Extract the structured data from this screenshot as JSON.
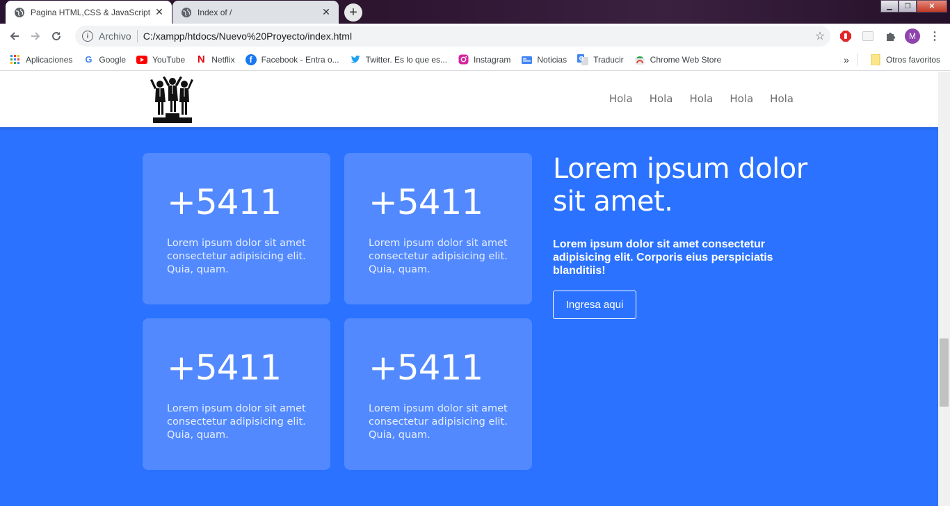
{
  "browser": {
    "tabs": [
      {
        "title": "Pagina HTML,CSS & JavaScript",
        "active": true
      },
      {
        "title": "Index of /",
        "active": false
      }
    ],
    "new_tab_label": "+",
    "address": {
      "scheme_label": "Archivo",
      "url": "C:/xampp/htdocs/Nuevo%20Proyecto/index.html"
    },
    "profile_initial": "M",
    "bookmarks": [
      {
        "label": "Aplicaciones",
        "icon": "apps-grid-icon"
      },
      {
        "label": "Google",
        "icon": "google-icon"
      },
      {
        "label": "YouTube",
        "icon": "youtube-icon"
      },
      {
        "label": "Netflix",
        "icon": "netflix-icon"
      },
      {
        "label": "Facebook - Entra o...",
        "icon": "facebook-icon"
      },
      {
        "label": "Twitter. Es lo que es...",
        "icon": "twitter-icon"
      },
      {
        "label": "Instagram",
        "icon": "instagram-icon"
      },
      {
        "label": "Noticias",
        "icon": "news-icon"
      },
      {
        "label": "Traducir",
        "icon": "translate-icon"
      },
      {
        "label": "Chrome Web Store",
        "icon": "chrome-web-store-icon"
      }
    ],
    "other_bookmarks_label": "Otros favoritos",
    "overflow_label": "»"
  },
  "page": {
    "nav": [
      "Hola",
      "Hola",
      "Hola",
      "Hola",
      "Hola"
    ],
    "cards": [
      {
        "number": "+5411",
        "text": "Lorem ipsum dolor sit amet consectetur adipisicing elit. Quia, quam."
      },
      {
        "number": "+5411",
        "text": "Lorem ipsum dolor sit amet consectetur adipisicing elit. Quia, quam."
      },
      {
        "number": "+5411",
        "text": "Lorem ipsum dolor sit amet consectetur adipisicing elit. Quia, quam."
      },
      {
        "number": "+5411",
        "text": "Lorem ipsum dolor sit amet consectetur adipisicing elit. Quia, quam."
      }
    ],
    "intro": {
      "heading": "Lorem ipsum dolor sit amet.",
      "text": "Lorem ipsum dolor sit amet consectetur adipisicing elit. Corporis eius perspiciatis blanditiis!",
      "button": "Ingresa aqui"
    }
  },
  "colors": {
    "hero_bg": "#2a72ff",
    "card_bg": "#5289ff",
    "tab_bar": "#2d1530"
  }
}
